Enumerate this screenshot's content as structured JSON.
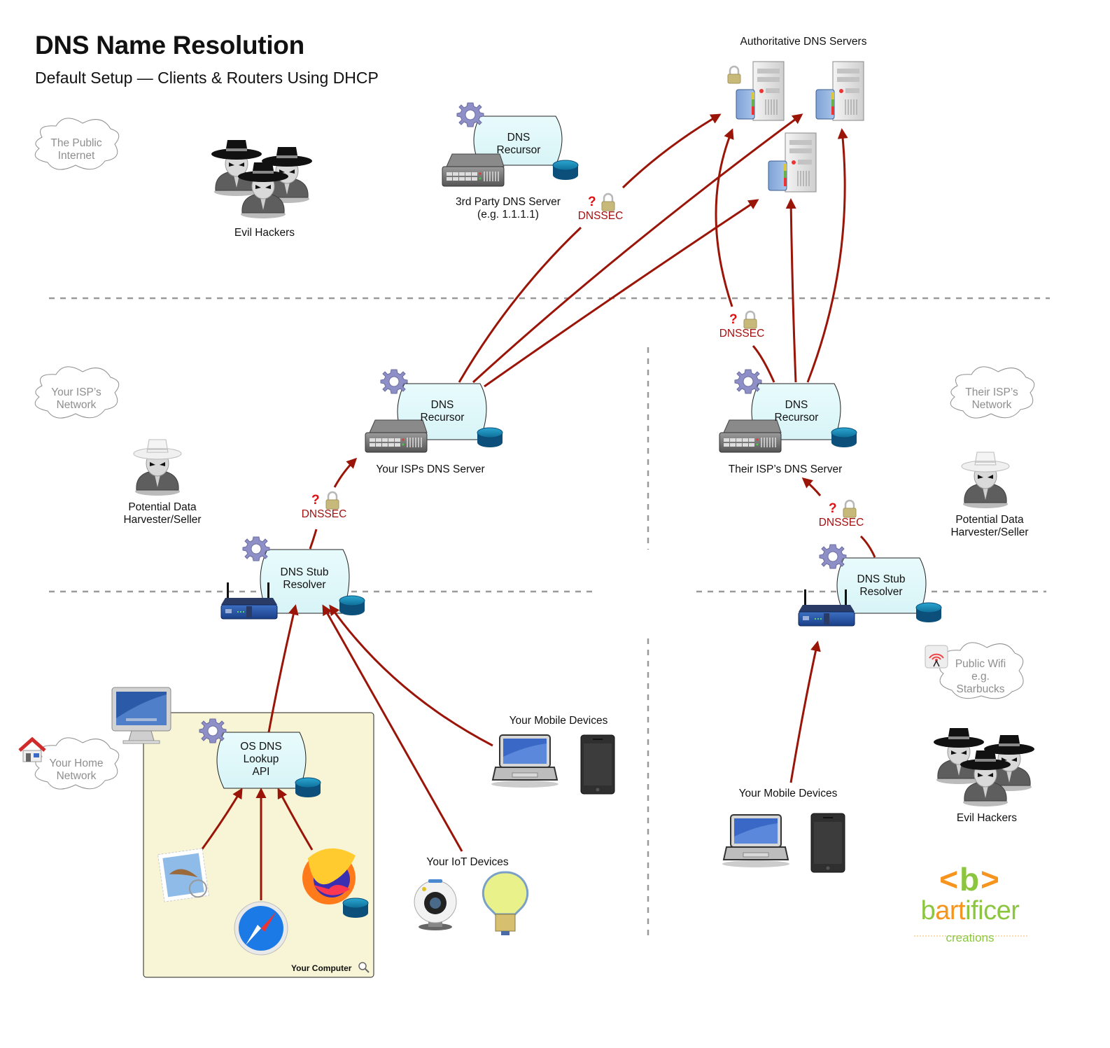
{
  "title": "DNS Name Resolution",
  "subtitle": "Default Setup — Clients & Routers Using DHCP",
  "colors": {
    "arrow": "#9a1508",
    "dnssec_text": "#a11010",
    "question_mark": "#e01010",
    "pill_fill": "#e0f8fa",
    "computer_panel": "#f8f5d6",
    "cloud_text": "#8e8e8e",
    "logo_green": "#8cc63f",
    "logo_orange": "#f7941d"
  },
  "zones": {
    "public_internet": "The Public Internet",
    "your_isp": "Your ISP’s Network",
    "their_isp": "Their ISP’s Network",
    "home": "Your Home Network",
    "public_wifi": "Public Wifi e.g. Starbucks"
  },
  "zone_lines": {
    "public_internet_1": "The Public",
    "public_internet_2": "Internet",
    "your_isp_1": "Your ISP’s",
    "your_isp_2": "Network",
    "their_isp_1": "Their ISP’s",
    "their_isp_2": "Network",
    "home_1": "Your Home",
    "home_2": "Network",
    "wifi_1": "Public Wifi",
    "wifi_2": "e.g.",
    "wifi_3": "Starbucks"
  },
  "actors": {
    "evil_hackers_top": "Evil Hackers",
    "evil_hackers_bottom": "Evil Hackers",
    "harvester_left_1": "Potential Data",
    "harvester_left_2": "Harvester/Seller",
    "harvester_right_1": "Potential Data",
    "harvester_right_2": "Harvester/Seller"
  },
  "nodes": {
    "third_party": {
      "line1": "DNS",
      "line2": "Recursor",
      "caption1": "3rd Party DNS Server",
      "caption2": "(e.g. 1.1.1.1)"
    },
    "authoritative": {
      "caption": "Authoritative DNS Servers"
    },
    "your_isp": {
      "line1": "DNS",
      "line2": "Recursor",
      "caption": "Your ISPs DNS Server"
    },
    "their_isp": {
      "line1": "DNS",
      "line2": "Recursor",
      "caption": "Their ISP’s DNS Server"
    },
    "home_stub": {
      "line1": "DNS Stub",
      "line2": "Resolver"
    },
    "wifi_stub": {
      "line1": "DNS Stub",
      "line2": "Resolver"
    },
    "os_api": {
      "line1": "OS DNS",
      "line2": "Lookup",
      "line3": "API"
    }
  },
  "dnssec": {
    "question": "?",
    "label": "DNSSEC"
  },
  "devices": {
    "computer_label": "Your Computer",
    "mobile_home": "Your Mobile Devices",
    "iot": "Your IoT Devices",
    "mobile_wifi": "Your Mobile Devices"
  },
  "logo": {
    "mark_open": "<",
    "mark_b": "b",
    "mark_close": ">",
    "word_a": "b",
    "word_b": "art",
    "word_c": "ificer",
    "tagline": "creations"
  }
}
